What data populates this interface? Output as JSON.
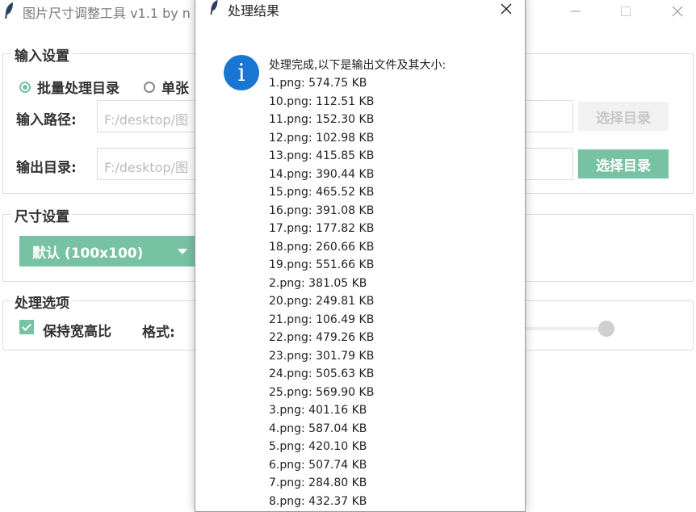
{
  "app": {
    "title": "图片尺寸调整工具 v1.1 by n"
  },
  "input_group": {
    "title": "输入设置",
    "radio_batch": "批量处理目录",
    "radio_single": "单张",
    "input_path_label": "输入路径:",
    "input_path_value": "F:/desktop/图",
    "output_dir_label": "输出目录:",
    "output_dir_value": "F:/desktop/图",
    "select_dir_label": "选择目录",
    "select_dir_label_2": "选择目录"
  },
  "size_group": {
    "title": "尺寸设置",
    "dropdown_value": "默认 (100x100)"
  },
  "options_group": {
    "title": "处理选项",
    "keep_ratio": "保持宽高比",
    "format_label": "格式:",
    "slider_level": 1.0
  },
  "dialog": {
    "title": "处理结果",
    "message": "处理完成,以下是输出文件及其大小:",
    "files": [
      "1.png: 574.75 KB",
      "10.png: 112.51 KB",
      "11.png: 152.30 KB",
      "12.png: 102.98 KB",
      "13.png: 415.85 KB",
      "14.png: 390.44 KB",
      "15.png: 465.52 KB",
      "16.png: 391.08 KB",
      "17.png: 177.82 KB",
      "18.png: 260.66 KB",
      "19.png: 551.66 KB",
      "2.png: 381.05 KB",
      "20.png: 249.81 KB",
      "21.png: 106.49 KB",
      "22.png: 479.26 KB",
      "23.png: 301.79 KB",
      "24.png: 505.63 KB",
      "25.png: 569.90 KB",
      "3.png: 401.16 KB",
      "4.png: 587.04 KB",
      "5.png: 420.10 KB",
      "6.png: 507.74 KB",
      "7.png: 284.80 KB",
      "8.png: 432.37 KB"
    ]
  },
  "colors": {
    "accent": "#78c2a4",
    "info_icon": "#1976d2"
  },
  "icons": {
    "app": "feather-icon",
    "info": "info-icon",
    "close": "close-icon",
    "dropdown": "caret-down-icon",
    "check": "check-icon"
  }
}
